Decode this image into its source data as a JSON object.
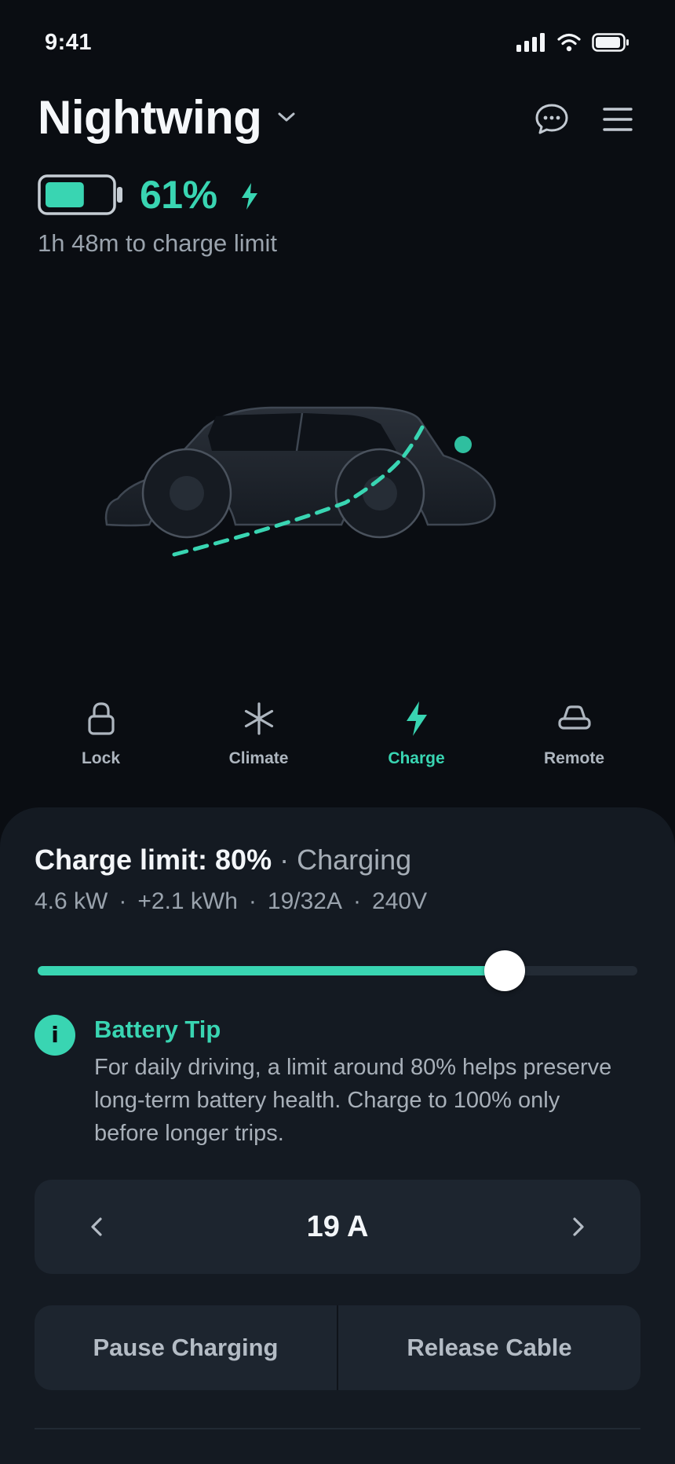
{
  "status_bar": {
    "time": "9:41"
  },
  "header": {
    "vehicle_name": "Nightwing"
  },
  "battery": {
    "percent_label": "61%",
    "level": 0.61,
    "charge_eta": "1h 48m to charge limit"
  },
  "quick_actions": [
    {
      "label": "Lock",
      "icon": "lock-icon",
      "active": false
    },
    {
      "label": "Climate",
      "icon": "climate-icon",
      "active": false
    },
    {
      "label": "Charge",
      "icon": "bolt-icon",
      "active": true
    },
    {
      "label": "Remote",
      "icon": "car-remote-icon",
      "active": false
    }
  ],
  "charging": {
    "limit_label": "Charge limit: 80%",
    "separator": " · ",
    "status": "Charging",
    "stats": [
      "4.6 kW",
      "+2.1 kWh",
      "19/32A",
      "240V"
    ],
    "stat_separator": "·",
    "limit_value": 0.8
  },
  "tip": {
    "icon_glyph": "i",
    "title": "Battery Tip",
    "body": "For daily driving, a limit around 80% helps preserve long-term battery health. Charge to 100% only before longer trips."
  },
  "amperage": {
    "value": "19 A"
  },
  "actions": {
    "pause": "Pause Charging",
    "release": "Release Cable"
  },
  "colors": {
    "accent": "#39d5b2",
    "background": "#0a0d12",
    "sheet": "#141a22",
    "control": "#1d252f"
  }
}
